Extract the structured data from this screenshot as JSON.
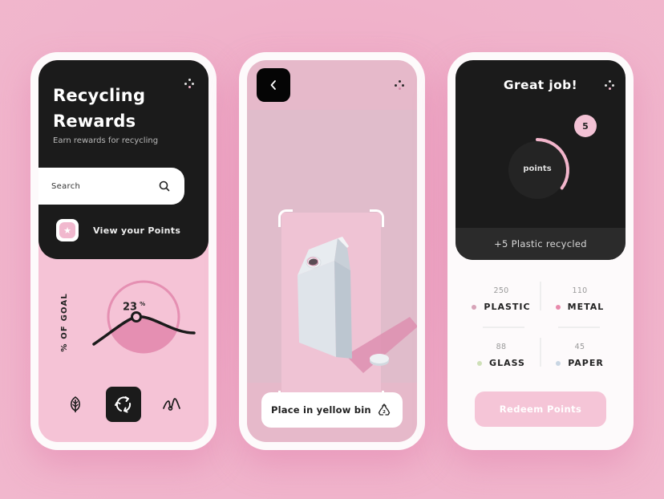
{
  "screen1": {
    "title_line1": "Recycling",
    "title_line2": "Rewards",
    "subtitle": "Earn rewards for recycling",
    "search": {
      "placeholder": "Search",
      "icon": "search-icon"
    },
    "view_points": {
      "label": "View your Points",
      "icon": "star-icon"
    },
    "goal": {
      "label": "% OF GOAL",
      "value": "23",
      "unit": "%",
      "progress_percent": 23
    },
    "nav": [
      {
        "icon": "leaf-icon",
        "active": false
      },
      {
        "icon": "recycle-icon",
        "active": true
      },
      {
        "icon": "mountain-icon",
        "active": false
      }
    ]
  },
  "screen2": {
    "back_icon": "chevron-left-icon",
    "menu_icon": "dots-menu-icon",
    "scanned_item": "milk carton",
    "instruction": {
      "label": "Place in yellow bin",
      "icon": "recycle-triangle-icon"
    }
  },
  "screen3": {
    "title": "Great job!",
    "points_label": "points",
    "points_badge": "5",
    "points_progress_fraction": 0.35,
    "recycled_message": "+5 Plastic recycled",
    "stats": [
      {
        "value": "250",
        "label": "PLASTIC",
        "color": "#d7a3b8"
      },
      {
        "value": "110",
        "label": "METAL",
        "color": "#e88aac"
      },
      {
        "value": "88",
        "label": "GLASS",
        "color": "#cfe0b8"
      },
      {
        "value": "45",
        "label": "PAPER",
        "color": "#c9d6e3"
      }
    ],
    "redeem_label": "Redeem Points"
  },
  "colors": {
    "background": "#f0b3cb",
    "dark": "#1b1b1b",
    "pink_accent": "#f3b6cc",
    "pink_deep": "#e58fb2"
  }
}
